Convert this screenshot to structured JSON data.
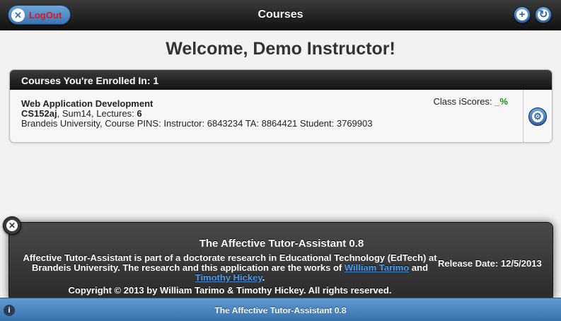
{
  "header": {
    "title": "Courses",
    "logout_label": "LogOut",
    "logout_icon": "close-icon",
    "add_icon": "plus-icon",
    "refresh_icon": "refresh-icon"
  },
  "welcome": "Welcome, Demo Instructor!",
  "courses_panel": {
    "heading": "Courses You're Enrolled In: 1",
    "courses": [
      {
        "name": "Web Application Development",
        "code": "CS152aj",
        "term_prefix": ", Sum14, Lectures: ",
        "lectures": "6",
        "details": "Brandeis University, Course PINS: Instructor: 6843234 TA: 8864421 Student: 3769903",
        "iscores_label": "Class iScores: ",
        "iscores_value": "_%",
        "settings_icon": "gear-icon"
      }
    ]
  },
  "popup": {
    "title": "The Affective Tutor-Assistant 0.8",
    "body_text": "Affective Tutor-Assistant is part of a doctorate research in Educational Technology (EdTech) at Brandeis University. The research and this application are the works of ",
    "author1": "William Tarimo",
    "and_text": " and ",
    "author2": "Timothy Hickey",
    "period": ".",
    "copyright": "Copyright © 2013 by William Tarimo & Timothy Hickey. All rights reserved.",
    "release": "Release Date: 12/5/2013",
    "close_icon": "close-icon"
  },
  "footer": {
    "title": "The Affective Tutor-Assistant 0.8",
    "info_icon": "info-icon"
  },
  "colors": {
    "accent_blue": "#3a74b1",
    "logout_red": "#e0141d",
    "score_green": "#1a8a1a",
    "link_blue": "#4a9ae6"
  }
}
